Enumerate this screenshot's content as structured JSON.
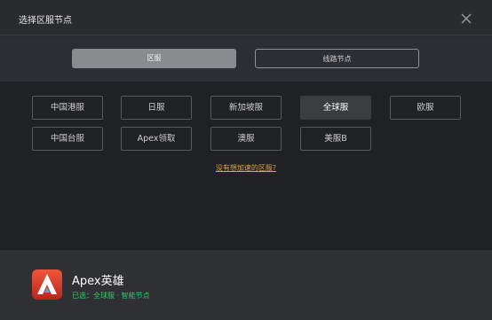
{
  "dialog": {
    "title": "选择区服节点"
  },
  "tabs": [
    {
      "label": "区服"
    },
    {
      "label": "线路节点"
    }
  ],
  "servers": [
    {
      "label": "中国港服"
    },
    {
      "label": "日服"
    },
    {
      "label": "新加坡服"
    },
    {
      "label": "全球服"
    },
    {
      "label": "欧服"
    },
    {
      "label": "中国台服"
    },
    {
      "label": "Apex领取"
    },
    {
      "label": "澳服"
    },
    {
      "label": "美服B"
    }
  ],
  "help_link": "没有想加速的区服?",
  "game": {
    "name": "Apex英雄",
    "status": "已选：全球服 · 智能节点"
  },
  "colors": {
    "background": "#2a2b2f",
    "content_background": "#202124",
    "active_tab": "#8a8b8e",
    "link": "#e0a33a",
    "status_green": "#34c76a"
  },
  "icons": {
    "close": "close-icon",
    "game": "apex-logo-icon"
  }
}
